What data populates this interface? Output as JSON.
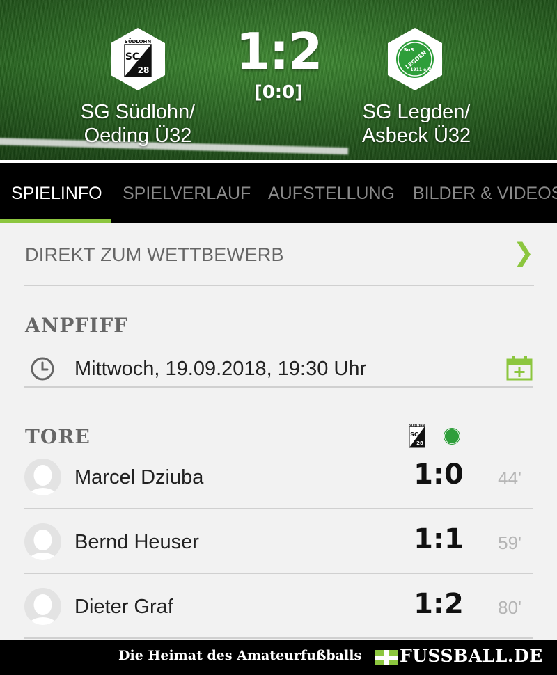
{
  "match": {
    "home_team": {
      "name_line1": "SG Südlohn/",
      "name_line2": "Oeding Ü32",
      "logo_text_top": "SÜDLOHN",
      "logo_text_main": "SC",
      "logo_text_num": "28"
    },
    "away_team": {
      "name_line1": "SG Legden/",
      "name_line2": "Asbeck Ü32",
      "logo_text_top": "SuS",
      "logo_text_main": "LEGDEN",
      "logo_text_num": "1911 e.V."
    },
    "score": "1:2",
    "halftime": "[0:0]"
  },
  "tabs": [
    {
      "label": "SPIELINFO",
      "active": true
    },
    {
      "label": "SPIELVERLAUF",
      "active": false
    },
    {
      "label": "AUFSTELLUNG",
      "active": false
    },
    {
      "label": "BILDER & VIDEOS",
      "active": false
    }
  ],
  "competition_link": {
    "label": "DIREKT ZUM WETTBEWERB",
    "icon": "chevron-right-icon"
  },
  "kickoff": {
    "heading": "ANPFIFF",
    "datetime": "Mittwoch, 19.09.2018, 19:30 Uhr",
    "icons": [
      "clock-icon",
      "calendar-add-icon"
    ]
  },
  "goals": {
    "heading": "TORE",
    "items": [
      {
        "player": "Marcel Dziuba",
        "score": "1:0",
        "minute": "44'"
      },
      {
        "player": "Bernd Heuser",
        "score": "1:1",
        "minute": "59'"
      },
      {
        "player": "Dieter Graf",
        "score": "1:2",
        "minute": "80'"
      }
    ]
  },
  "footer": {
    "tagline": "Die Heimat des Amateurfußballs",
    "brand": "FUSSBALL.DE"
  },
  "colors": {
    "accent": "#8cc63f",
    "tab_bar": "#000000",
    "away_green": "#2e9e3a"
  }
}
